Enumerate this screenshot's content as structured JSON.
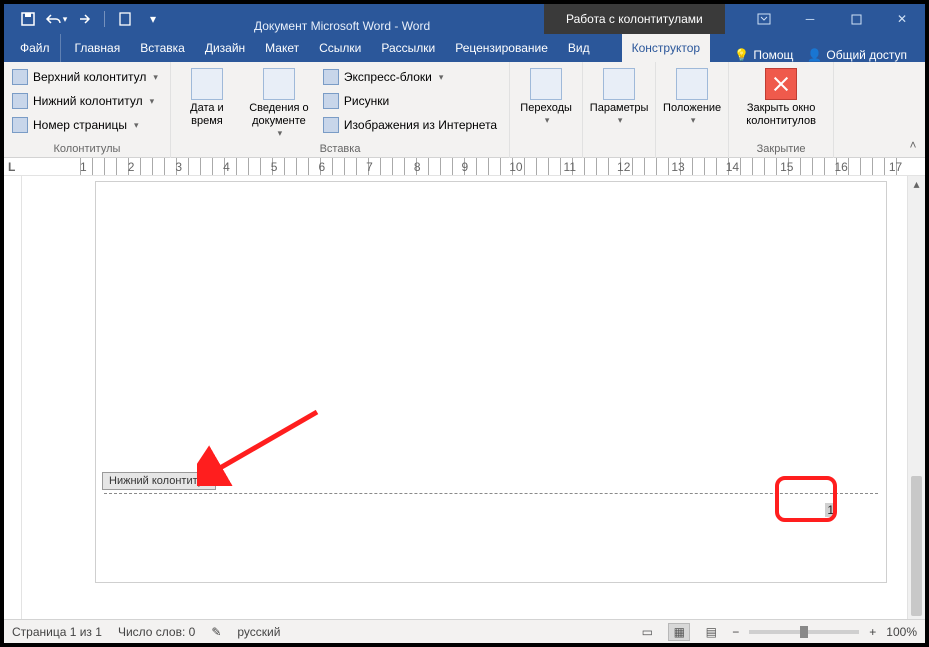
{
  "title": {
    "document": "Документ Microsoft Word - Word",
    "context_group": "Работа с колонтитулами"
  },
  "qat": {
    "save": "save",
    "undo": "undo",
    "redo": "redo",
    "new": "new"
  },
  "tabs": {
    "file": "Файл",
    "items": [
      "Главная",
      "Вставка",
      "Дизайн",
      "Макет",
      "Ссылки",
      "Рассылки",
      "Рецензирование",
      "Вид"
    ],
    "contextual": "Конструктор",
    "help": "Помощ",
    "share": "Общий доступ"
  },
  "ribbon": {
    "headers_footers": {
      "label": "Колонтитулы",
      "header": "Верхний колонтитул",
      "footer": "Нижний колонтитул",
      "page_number": "Номер страницы"
    },
    "datetime": {
      "label": "Дата и время"
    },
    "docinfo": {
      "label": "Сведения о документе"
    },
    "insert": {
      "label": "Вставка",
      "quickparts": "Экспресс-блоки",
      "pictures": "Рисунки",
      "online_pictures": "Изображения из Интернета"
    },
    "navigation": {
      "label": "Переходы"
    },
    "options": {
      "label": "Параметры"
    },
    "position": {
      "label": "Положение"
    },
    "close": {
      "btn": "Закрыть окно колонтитулов",
      "label": "Закрытие"
    }
  },
  "ruler": {
    "corner": "L",
    "numbers": [
      "1",
      "2",
      "1",
      "",
      "1",
      "2",
      "3",
      "4",
      "5",
      "6",
      "7",
      "8",
      "9",
      "10",
      "11",
      "12",
      "13",
      "14",
      "15",
      "16",
      "17"
    ]
  },
  "document": {
    "footer_tab": "Нижний колонтитул",
    "page_number_value": "1"
  },
  "status": {
    "page": "Страница 1 из 1",
    "words": "Число слов: 0",
    "language": "русский",
    "zoom_minus": "−",
    "zoom_plus": "+",
    "zoom": "100%"
  }
}
